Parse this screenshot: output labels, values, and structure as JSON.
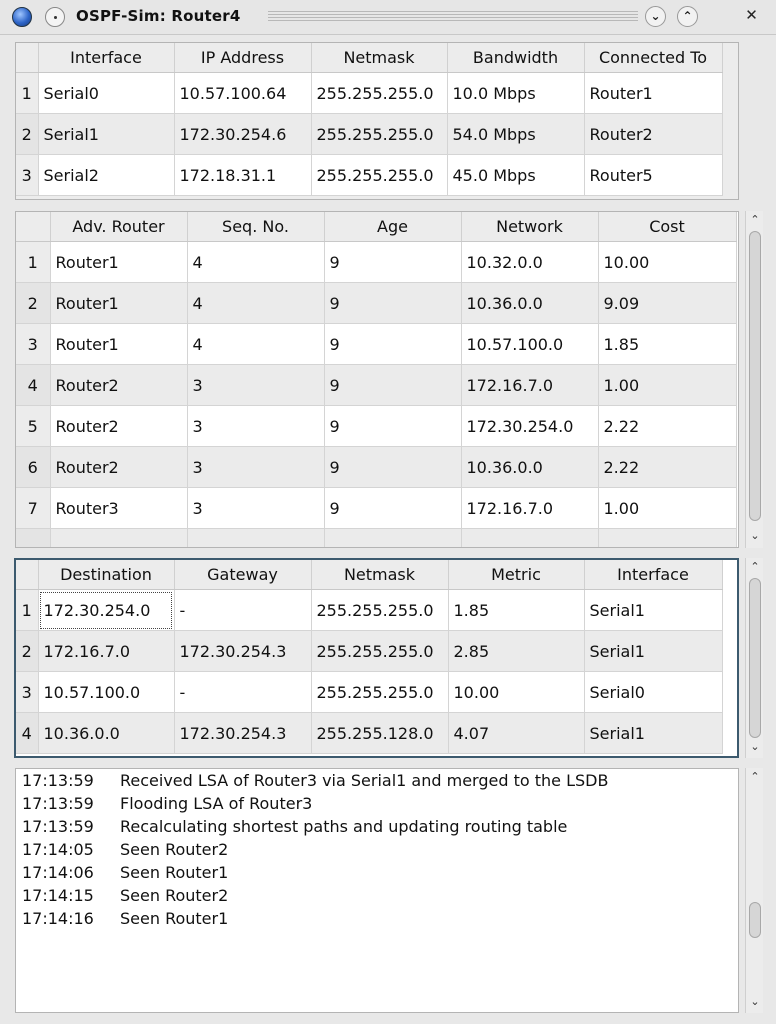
{
  "window": {
    "title": "OSPF-Sim: Router4",
    "app_icon": "globe-icon",
    "menu_icon": "window-menu-icon",
    "buttons": {
      "minimize": "⌄",
      "maximize": "⌃",
      "close": "✕"
    }
  },
  "interfaces": {
    "columns": [
      "Interface",
      "IP Address",
      "Netmask",
      "Bandwidth",
      "Connected To"
    ],
    "rows": [
      {
        "n": "1",
        "cells": [
          "Serial0",
          "10.57.100.64",
          "255.255.255.0",
          "10.0 Mbps",
          "Router1"
        ]
      },
      {
        "n": "2",
        "cells": [
          "Serial1",
          "172.30.254.6",
          "255.255.255.0",
          "54.0 Mbps",
          "Router2"
        ]
      },
      {
        "n": "3",
        "cells": [
          "Serial2",
          "172.18.31.1",
          "255.255.255.0",
          "45.0 Mbps",
          "Router5"
        ]
      }
    ]
  },
  "lsdb": {
    "columns": [
      "Adv. Router",
      "Seq. No.",
      "Age",
      "Network",
      "Cost"
    ],
    "rows": [
      {
        "n": "1",
        "cells": [
          "Router1",
          "4",
          "9",
          "10.32.0.0",
          "10.00"
        ]
      },
      {
        "n": "2",
        "cells": [
          "Router1",
          "4",
          "9",
          "10.36.0.0",
          "9.09"
        ]
      },
      {
        "n": "3",
        "cells": [
          "Router1",
          "4",
          "9",
          "10.57.100.0",
          "1.85"
        ]
      },
      {
        "n": "4",
        "cells": [
          "Router2",
          "3",
          "9",
          "172.16.7.0",
          "1.00"
        ]
      },
      {
        "n": "5",
        "cells": [
          "Router2",
          "3",
          "9",
          "172.30.254.0",
          "2.22"
        ]
      },
      {
        "n": "6",
        "cells": [
          "Router2",
          "3",
          "9",
          "10.36.0.0",
          "2.22"
        ]
      },
      {
        "n": "7",
        "cells": [
          "Router3",
          "3",
          "9",
          "172.16.7.0",
          "1.00"
        ]
      }
    ]
  },
  "routing": {
    "columns": [
      "Destination",
      "Gateway",
      "Netmask",
      "Metric",
      "Interface"
    ],
    "rows": [
      {
        "n": "1",
        "cells": [
          "172.30.254.0",
          "-",
          "255.255.255.0",
          "1.85",
          "Serial1"
        ]
      },
      {
        "n": "2",
        "cells": [
          "172.16.7.0",
          "172.30.254.3",
          "255.255.255.0",
          "2.85",
          "Serial1"
        ]
      },
      {
        "n": "3",
        "cells": [
          "10.57.100.0",
          "-",
          "255.255.255.0",
          "10.00",
          "Serial0"
        ]
      },
      {
        "n": "4",
        "cells": [
          "10.36.0.0",
          "172.30.254.3",
          "255.255.128.0",
          "4.07",
          "Serial1"
        ]
      }
    ]
  },
  "log": [
    {
      "time": "17:13:59",
      "message": "Received LSA of Router3 via Serial1 and merged to the LSDB"
    },
    {
      "time": "17:13:59",
      "message": "Flooding LSA of Router3"
    },
    {
      "time": "17:13:59",
      "message": "Recalculating shortest paths and updating routing table"
    },
    {
      "time": "17:14:05",
      "message": "Seen Router2"
    },
    {
      "time": "17:14:06",
      "message": "Seen Router1"
    },
    {
      "time": "17:14:15",
      "message": "Seen Router2"
    },
    {
      "time": "17:14:16",
      "message": "Seen Router1"
    }
  ],
  "scroll": {
    "up": "⌃",
    "down": "⌄"
  }
}
